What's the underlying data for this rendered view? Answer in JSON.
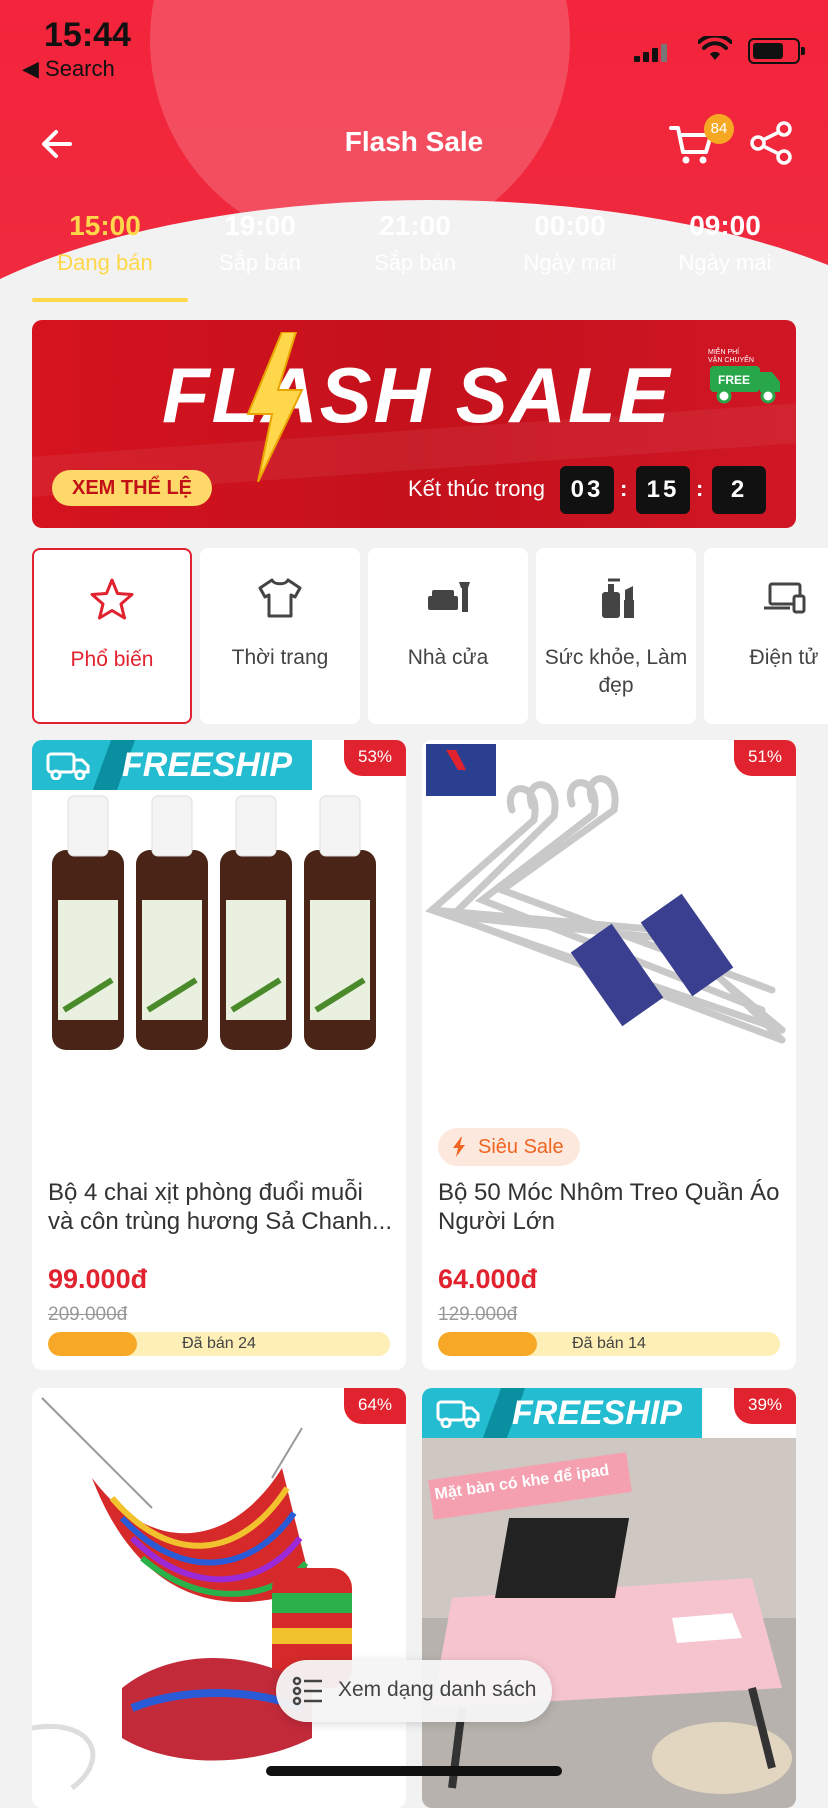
{
  "status": {
    "time": "15:44",
    "back_app": "◀ Search"
  },
  "topbar": {
    "title": "Flash Sale",
    "cart_count": "84"
  },
  "slots": [
    {
      "time": "15:00",
      "label": "Đang bán",
      "active": true
    },
    {
      "time": "19:00",
      "label": "Sắp bán"
    },
    {
      "time": "21:00",
      "label": "Sắp bán"
    },
    {
      "time": "00:00",
      "label": "Ngày mai"
    },
    {
      "time": "09:00",
      "label": "Ngày mai"
    }
  ],
  "banner": {
    "headline": "FLASH SALE",
    "free_badge_text": "MIỄN PHÍ VẬN CHUYỂN FREE",
    "rules_button": "XEM THỂ LỆ",
    "ends_label": "Kết thúc trong",
    "hours": "03",
    "minutes": "15",
    "seconds": "2"
  },
  "categories": [
    {
      "label": "Phổ biến",
      "icon": "star-icon",
      "active": true
    },
    {
      "label": "Thời trang",
      "icon": "shirt-icon"
    },
    {
      "label": "Nhà cửa",
      "icon": "sofa-icon"
    },
    {
      "label": "Sức khỏe, Làm đẹp",
      "icon": "cosmetics-icon"
    },
    {
      "label": "Điện tử",
      "icon": "laptop-icon"
    }
  ],
  "products": [
    {
      "name": "Bộ 4 chai xịt phòng đuổi muỗi và côn trùng hương Sả Chanh...",
      "price": "99.000đ",
      "old_price": "209.000đ",
      "sold": "Đã bán 24",
      "discount": "53%",
      "freeship_text": "FREESHIP",
      "sold_fraction": 0.26
    },
    {
      "name": "Bộ 50 Móc Nhôm Treo Quần Áo Người Lớn",
      "price": "64.000đ",
      "old_price": "129.000đ",
      "sold": "Đã bán 14",
      "discount": "51%",
      "sieu_sale": "Siêu Sale",
      "sold_fraction": 0.29
    },
    {
      "discount": "64%"
    },
    {
      "discount": "39%",
      "freeship_text": "FREESHIP",
      "image_caption": "Mặt bàn có khe để ipad"
    }
  ],
  "list_view_button": "Xem dạng danh sách",
  "colors": {
    "primary": "#e0232f",
    "accent": "#ffd74a",
    "freeship": "#23bcd0",
    "progress": "#f7a826"
  }
}
